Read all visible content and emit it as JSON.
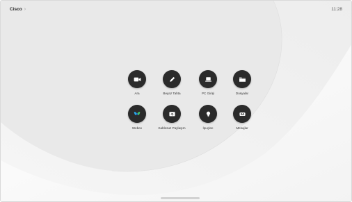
{
  "topbar": {
    "brand": "Cisco",
    "chevron": "›",
    "time": "11:28"
  },
  "apps": [
    {
      "label": "Ara",
      "icon": "video-camera-icon"
    },
    {
      "label": "Beyaz Tahta",
      "icon": "pencil-icon"
    },
    {
      "label": "PC Girişi",
      "icon": "laptop-icon"
    },
    {
      "label": "Dosyalar",
      "icon": "folder-icon"
    },
    {
      "label": "Webex",
      "icon": "webex-logo-icon"
    },
    {
      "label": "Kablosuz Paylaşım",
      "icon": "wireless-share-icon"
    },
    {
      "label": "İpuçları",
      "icon": "lightbulb-icon"
    },
    {
      "label": "Mesajlar",
      "icon": "voicemail-icon"
    }
  ],
  "colors": {
    "tile_background": "#2b2b2b",
    "webex_blue": "#2aa5e8",
    "webex_green": "#44c36a"
  }
}
